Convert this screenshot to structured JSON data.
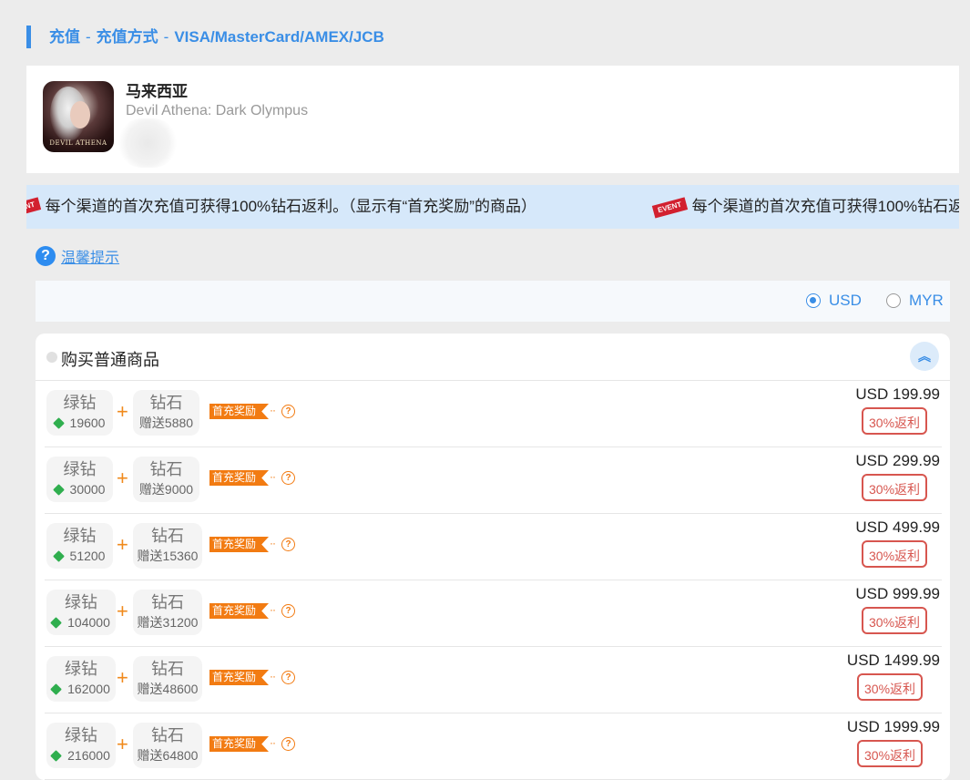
{
  "breadcrumb": {
    "part1": "充值",
    "part2": "充值方式",
    "part3": "VISA/MasterCard/AMEX/JCB",
    "sep": "-"
  },
  "game": {
    "region": "马来西亚",
    "name": "Devil Athena: Dark Olympus",
    "icon_text": "DEVIL ATHENA"
  },
  "marquee": {
    "event_tag": "EVENT",
    "text": "每个渠道的首次充值可获得100%钻石返利。（显示有“首充奖励”的商品）",
    "text_visible_2": "每个渠道的首次充值可获得100%钻石返"
  },
  "tip": {
    "icon": "question-icon",
    "label": "温馨提示"
  },
  "currency": {
    "options": [
      "USD",
      "MYR"
    ],
    "selected": "USD"
  },
  "panel": {
    "title": "购买普通商品",
    "collapse_icon": "chevron-up-double-icon"
  },
  "labels": {
    "green_diamond": "绿钻",
    "diamond": "钻石",
    "first_bonus": "首充奖励",
    "plus": "+",
    "help": "?",
    "dots": "··"
  },
  "products": [
    {
      "green": "19600",
      "bonus": "赠送5880",
      "price": "USD 199.99",
      "rebate": "30%返利"
    },
    {
      "green": "30000",
      "bonus": "赠送9000",
      "price": "USD 299.99",
      "rebate": "30%返利"
    },
    {
      "green": "51200",
      "bonus": "赠送15360",
      "price": "USD 499.99",
      "rebate": "30%返利"
    },
    {
      "green": "104000",
      "bonus": "赠送31200",
      "price": "USD 999.99",
      "rebate": "30%返利"
    },
    {
      "green": "162000",
      "bonus": "赠送48600",
      "price": "USD 1499.99",
      "rebate": "30%返利"
    },
    {
      "green": "216000",
      "bonus": "赠送64800",
      "price": "USD 1999.99",
      "rebate": "30%返利"
    }
  ],
  "colors": {
    "accent": "#3a8ee6",
    "orange": "#f27b12",
    "rebate_red": "#d7564f",
    "event_red": "#d2202f",
    "gem_green": "#2fae4e"
  }
}
